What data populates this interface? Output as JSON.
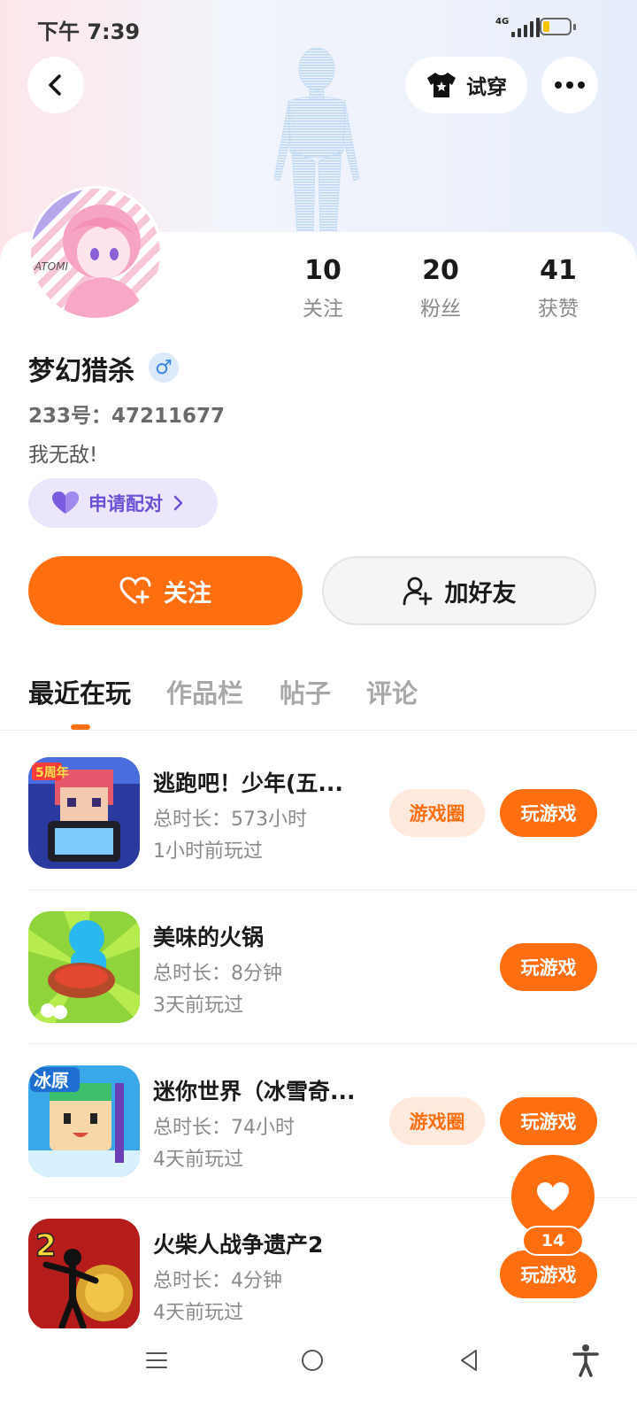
{
  "status_bar": {
    "time": "下午 7:39",
    "network": "4G",
    "battery_level": 0.25
  },
  "header": {
    "tryon_label": "试穿",
    "back_icon": "chevron-left-icon",
    "more_icon": "more-horizontal-icon",
    "tryon_icon": "tshirt-icon"
  },
  "profile": {
    "avatar_text": "ATOMI",
    "stats": [
      {
        "value": "10",
        "label": "关注"
      },
      {
        "value": "20",
        "label": "粉丝"
      },
      {
        "value": "41",
        "label": "获赞"
      }
    ],
    "username": "梦幻猎杀",
    "gender_symbol": "♂",
    "uid": "233号：47211677",
    "bio": "我无敌!",
    "pair_label": "申请配对"
  },
  "actions": {
    "follow_label": "关注",
    "add_friend_label": "加好友"
  },
  "tabs": [
    "最近在玩",
    "作品栏",
    "帖子",
    "评论"
  ],
  "games": [
    {
      "name": "逃跑吧！少年(五...",
      "duration": "总时长：573小时",
      "last_played": "1小时前玩过",
      "icon_text": "5周年",
      "has_circle": true,
      "circle_label": "游戏圈",
      "play_label": "玩游戏"
    },
    {
      "name": "美味的火锅",
      "duration": "总时长：8分钟",
      "last_played": "3天前玩过",
      "icon_text": "",
      "has_circle": false,
      "circle_label": "",
      "play_label": "玩游戏"
    },
    {
      "name": "迷你世界（冰雪奇...",
      "duration": "总时长：74小时",
      "last_played": "4天前玩过",
      "icon_text": "冰原",
      "has_circle": true,
      "circle_label": "游戏圈",
      "play_label": "玩游戏"
    },
    {
      "name": "火柴人战争遗产2",
      "duration": "总时长：4分钟",
      "last_played": "4天前玩过",
      "icon_text": "2",
      "has_circle": false,
      "circle_label": "",
      "play_label": "玩游戏"
    }
  ],
  "fab": {
    "count": "14"
  },
  "colors": {
    "accent": "#ff6e0f",
    "accent_soft": "#ffeadd",
    "pair_purple": "#6c4fd4"
  }
}
